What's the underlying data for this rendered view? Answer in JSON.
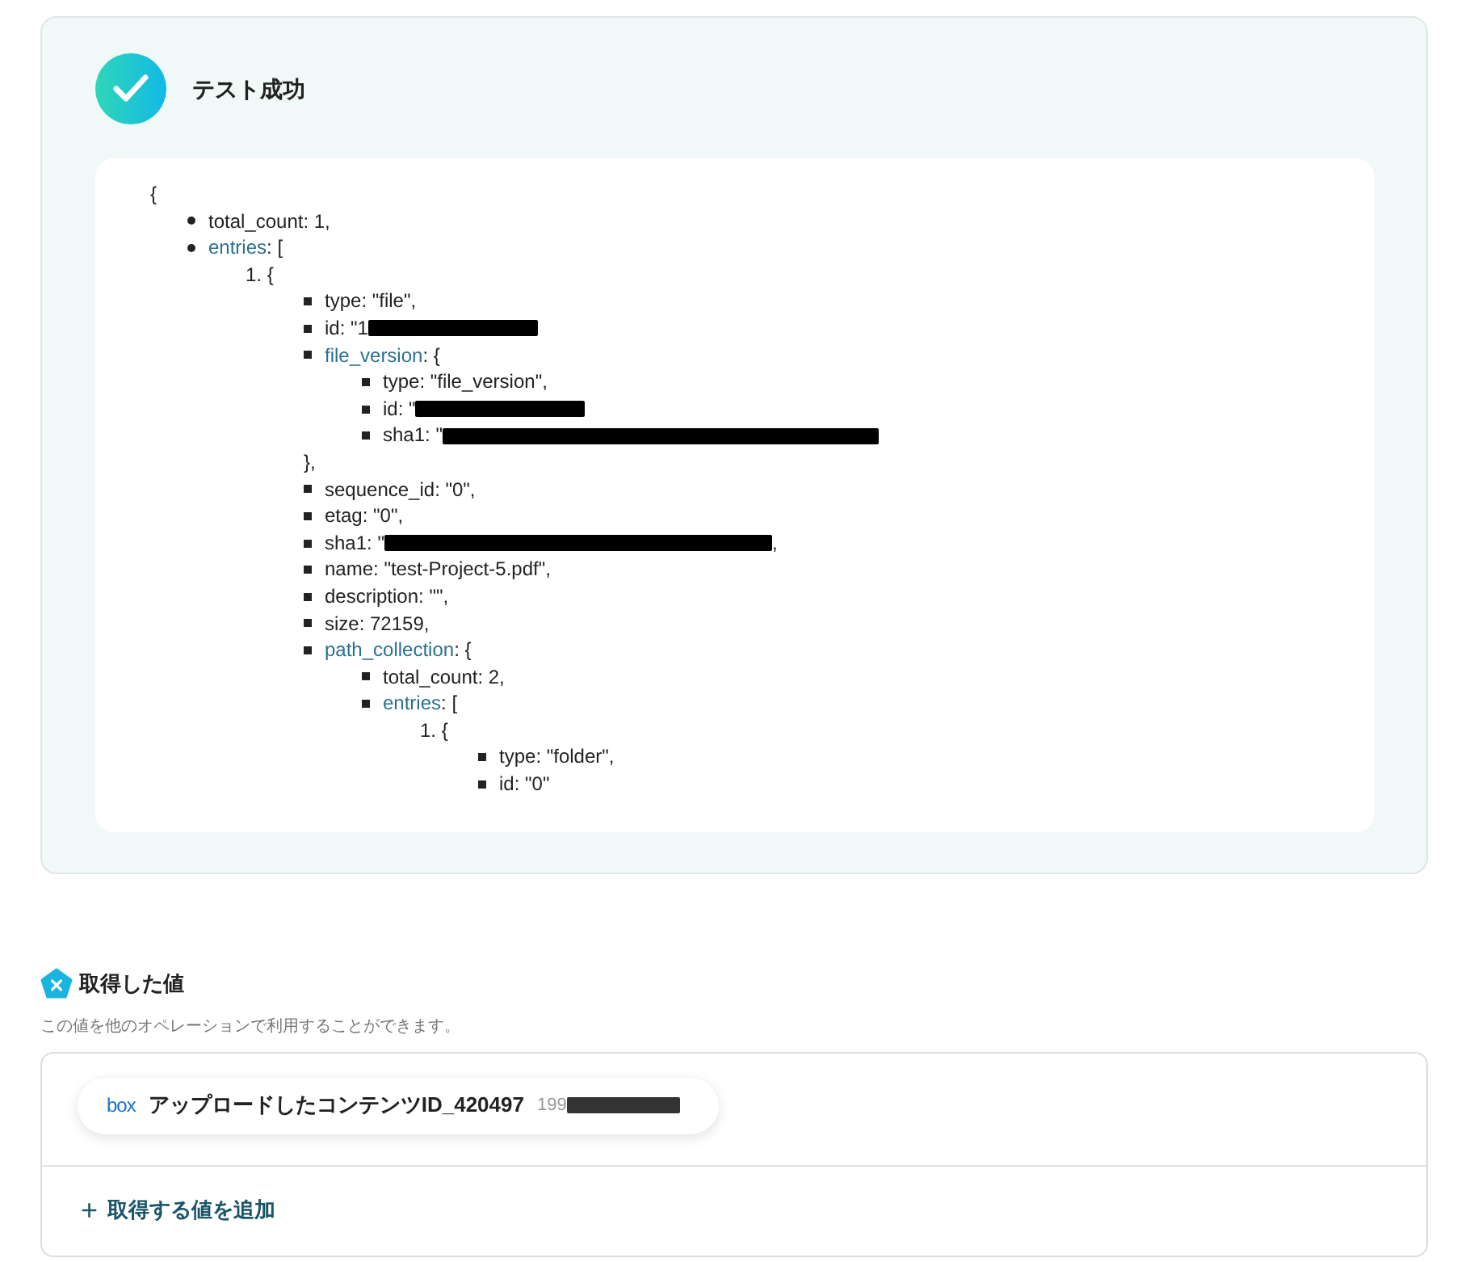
{
  "test_result": {
    "title": "テスト成功",
    "passed": true,
    "json_open": "{",
    "lines": [
      {
        "key": "total_count",
        "value": ": 1,"
      },
      {
        "key": "entries",
        "link": true,
        "value": ": [",
        "items": [
          {
            "number": "1.",
            "value": "{",
            "items": [
              {
                "key": "type",
                "value": ": \"file\","
              },
              {
                "key": "id",
                "value": ": \"1",
                "redacted": true
              },
              {
                "key": "file_version",
                "link": true,
                "value": ": {",
                "close": "},",
                "items": [
                  {
                    "key": "type",
                    "value": ": \"file_version\","
                  },
                  {
                    "key": "id",
                    "value": ": \"",
                    "redacted": true
                  },
                  {
                    "key": "sha1",
                    "value": ": \"",
                    "redacted": true
                  }
                ]
              },
              {
                "key": "sequence_id",
                "value": ": \"0\","
              },
              {
                "key": "etag",
                "value": ": \"0\","
              },
              {
                "key": "sha1",
                "value": ": \"",
                "redacted": true,
                "after": ","
              },
              {
                "key": "name",
                "value": ": \"test-Project-5.pdf\","
              },
              {
                "key": "description",
                "value": ": \"\","
              },
              {
                "key": "size",
                "value": ": 72159,"
              },
              {
                "key": "path_collection",
                "link": true,
                "value": ": {",
                "items": [
                  {
                    "key": "total_count",
                    "value": ": 2,"
                  },
                  {
                    "key": "entries",
                    "link": true,
                    "value": ": [",
                    "items": [
                      {
                        "number": "1.",
                        "value": "{",
                        "items": [
                          {
                            "key": "type",
                            "value": ": \"folder\","
                          },
                          {
                            "key": "id",
                            "value": ": \"0\""
                          }
                        ]
                      }
                    ]
                  }
                ]
              }
            ]
          }
        ]
      }
    ]
  },
  "values_section": {
    "title": "取得した値",
    "subtitle": "この値を他のオペレーションで利用することができます。",
    "chips": [
      {
        "logo": "box",
        "label": "アップロードしたコンテンツID_420497",
        "value": "199",
        "redacted": true
      }
    ],
    "add_button": {
      "icon": "+",
      "label": "取得する値を追加"
    }
  }
}
